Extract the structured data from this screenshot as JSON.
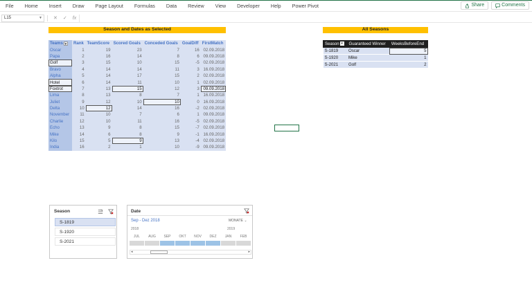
{
  "ribbon": {
    "tabs": [
      "File",
      "Home",
      "Insert",
      "Draw",
      "Page Layout",
      "Formulas",
      "Data",
      "Review",
      "View",
      "Developer",
      "Help",
      "Power Pivot"
    ],
    "share_label": "Share",
    "comments_label": "Comments"
  },
  "formula_bar": {
    "name_box": "L15",
    "cancel_icon": "✕",
    "enter_icon": "✓",
    "fx_label": "fx",
    "value": ""
  },
  "season_table": {
    "title": "Season and Dates as Selected",
    "headers": [
      "Teams",
      "Rank",
      "TeamScore",
      "Scored Goals",
      "Conceded Goals",
      "GoalDiff",
      "FirstMatch"
    ],
    "rows": [
      [
        "Oscar",
        "1",
        "19",
        "23",
        "7",
        "16",
        "02.09.2018"
      ],
      [
        "Papa",
        "2",
        "16",
        "14",
        "8",
        "6",
        "09.09.2018"
      ],
      [
        "Golf",
        "3",
        "15",
        "10",
        "15",
        "-5",
        "02.09.2018"
      ],
      [
        "Bravo",
        "4",
        "14",
        "14",
        "11",
        "3",
        "16.09.2018"
      ],
      [
        "Alpha",
        "5",
        "14",
        "17",
        "15",
        "2",
        "02.09.2018"
      ],
      [
        "Hotel",
        "6",
        "14",
        "11",
        "10",
        "1",
        "02.09.2018"
      ],
      [
        "Foxtrot",
        "7",
        "13",
        "15",
        "12",
        "3",
        "09.09.2018"
      ],
      [
        "Lima",
        "8",
        "13",
        "8",
        "7",
        "1",
        "16.09.2018"
      ],
      [
        "Juliet",
        "9",
        "12",
        "10",
        "10",
        "0",
        "16.09.2018"
      ],
      [
        "Delta",
        "10",
        "12",
        "14",
        "16",
        "-2",
        "02.09.2018"
      ],
      [
        "November",
        "11",
        "10",
        "7",
        "6",
        "1",
        "09.09.2018"
      ],
      [
        "Charlie",
        "12",
        "10",
        "11",
        "16",
        "-5",
        "02.09.2018"
      ],
      [
        "Echo",
        "13",
        "9",
        "8",
        "15",
        "-7",
        "02.09.2018"
      ],
      [
        "Mike",
        "14",
        "6",
        "8",
        "9",
        "-1",
        "16.09.2018"
      ],
      [
        "Kilo",
        "15",
        "5",
        "9",
        "13",
        "-4",
        "02.09.2018"
      ],
      [
        "India",
        "16",
        "2",
        "1",
        "10",
        "-9",
        "09.09.2018"
      ]
    ]
  },
  "all_seasons": {
    "title": "All Seasons",
    "headers": [
      "Season",
      "Guaranteed Winner",
      "WeeksBeforeEnd"
    ],
    "rows": [
      [
        "S-1819",
        "Oscar",
        "5"
      ],
      [
        "S-1920",
        "Mike",
        "1"
      ],
      [
        "S-2021",
        "Golf",
        "2"
      ]
    ]
  },
  "season_slicer": {
    "title": "Season",
    "items": [
      "S-1819",
      "S-1920",
      "S-2021"
    ],
    "selected": "S-1819"
  },
  "date_timeline": {
    "title": "Date",
    "range_label": "Sep - Dez 2018",
    "level_label": "MONATE",
    "year_left": "2018",
    "year_right": "2019",
    "months": [
      "JUL",
      "AUG",
      "SEP",
      "OKT",
      "NOV",
      "DEZ",
      "JAN",
      "FEB"
    ],
    "selected_months": [
      "SEP",
      "OKT",
      "NOV",
      "DEZ"
    ]
  },
  "colors": {
    "accent_green": "#217346",
    "title_bar": "#ffc000",
    "table_blue": "#d9e1f2",
    "team_col_blue": "#b4c6e7",
    "header_text_blue": "#4472c4",
    "timeline_selected": "#9dc3e6"
  }
}
